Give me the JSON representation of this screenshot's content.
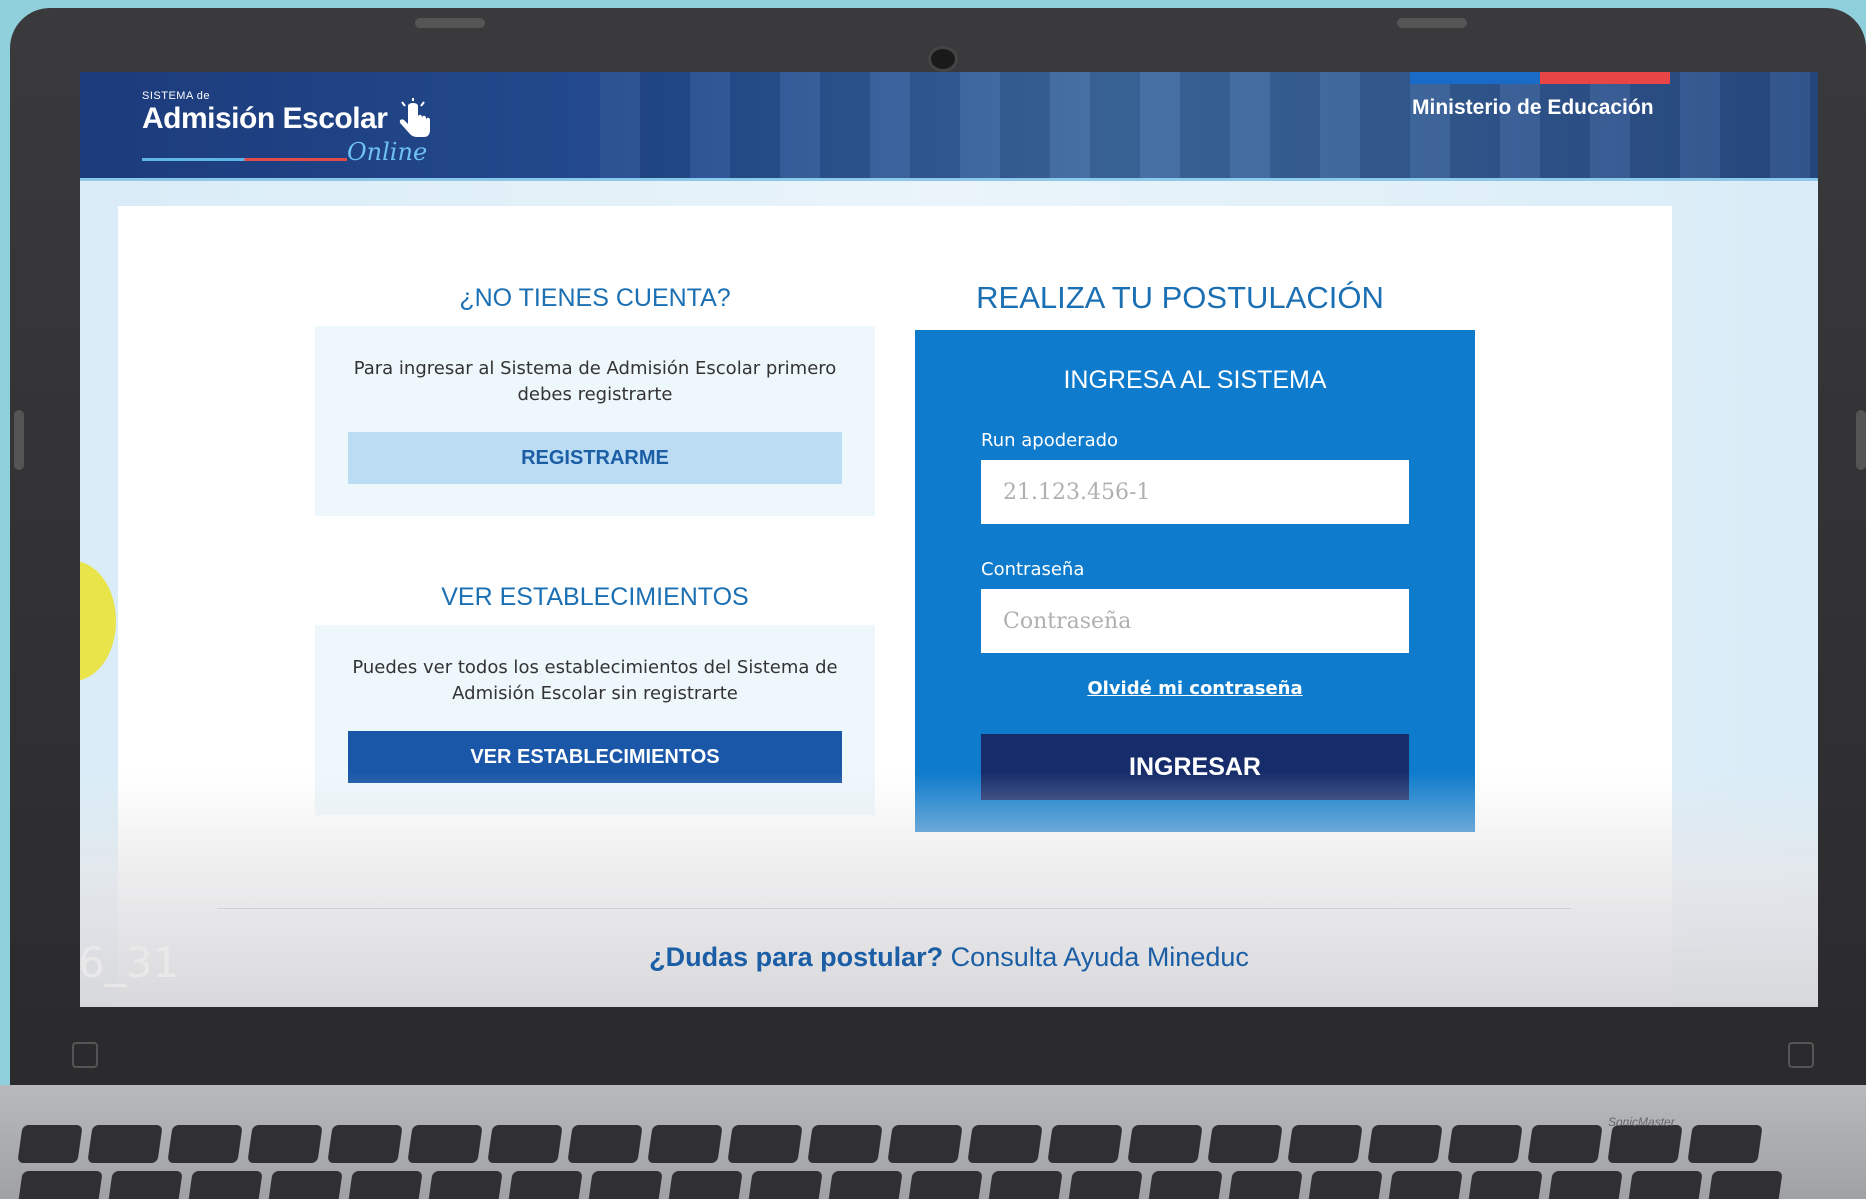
{
  "header": {
    "logo_small": "SISTEMA de",
    "logo_main": "Admisión Escolar",
    "logo_online": "Online",
    "ministry": "Ministerio de Educación"
  },
  "register_section": {
    "title": "¿NO TIENES CUENTA?",
    "text": "Para ingresar al Sistema de Admisión Escolar primero debes registrarte",
    "button": "REGISTRARME"
  },
  "schools_section": {
    "title": "VER ESTABLECIMIENTOS",
    "text": "Puedes ver todos los establecimientos del Sistema de Admisión Escolar sin registrarte",
    "button": "VER ESTABLECIMIENTOS"
  },
  "login": {
    "title": "REALIZA TU POSTULACIÓN",
    "heading": "INGRESA AL SISTEMA",
    "run_label": "Run apoderado",
    "run_placeholder": "21.123.456-1",
    "password_label": "Contraseña",
    "password_placeholder": "Contraseña",
    "forgot": "Olvidé mi contraseña",
    "submit": "INGRESAR"
  },
  "footer": {
    "help_strong": "¿Dudas para postular?",
    "help_rest": " Consulta Ayuda Mineduc"
  },
  "overlay": {
    "number": "6_31"
  },
  "laptop": {
    "brand": "SonicMaster"
  },
  "colors": {
    "header": "#1c3b7c",
    "accent": "#1b6fb3",
    "login_panel": "#0e7bcc",
    "submit_button": "#172d6b",
    "schools_button": "#1a57a8",
    "register_button": "#bbdcf3"
  }
}
